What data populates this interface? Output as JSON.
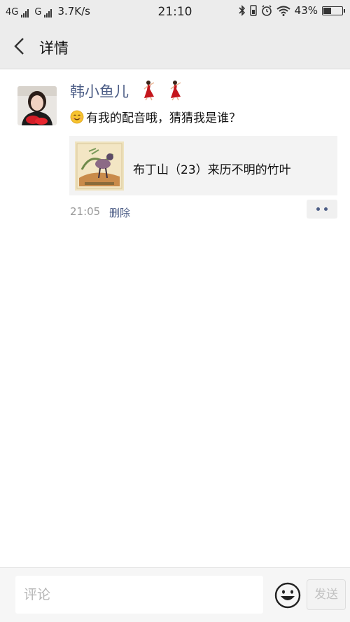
{
  "status_bar": {
    "network1": "4G",
    "network2": "G",
    "speed": "3.7K/s",
    "time": "21:10",
    "battery_text": "43%",
    "battery_level": 0.43,
    "icons": [
      "bluetooth-icon",
      "sim-icon",
      "alarm-icon",
      "wifi-icon",
      "battery-icon"
    ]
  },
  "header": {
    "title": "详情",
    "back_icon": "chevron-left-icon"
  },
  "post": {
    "author": "韩小鱼儿",
    "author_emoji": [
      "dancer-emoji",
      "dancer-emoji"
    ],
    "emoji": "smile-emoji",
    "text": "有我的配音哦，猜猜我是谁？",
    "share": {
      "title": "布丁山（23）来历不明的竹叶"
    },
    "time": "21:05",
    "delete_label": "删除",
    "more_icon": "more-dots-icon"
  },
  "comment_bar": {
    "placeholder": "评论",
    "send_label": "发送",
    "emoji_icon": "emoji-icon"
  },
  "colors": {
    "link": "#4c5d86",
    "header_bg": "#ececec",
    "card_bg": "#f3f3f3"
  }
}
